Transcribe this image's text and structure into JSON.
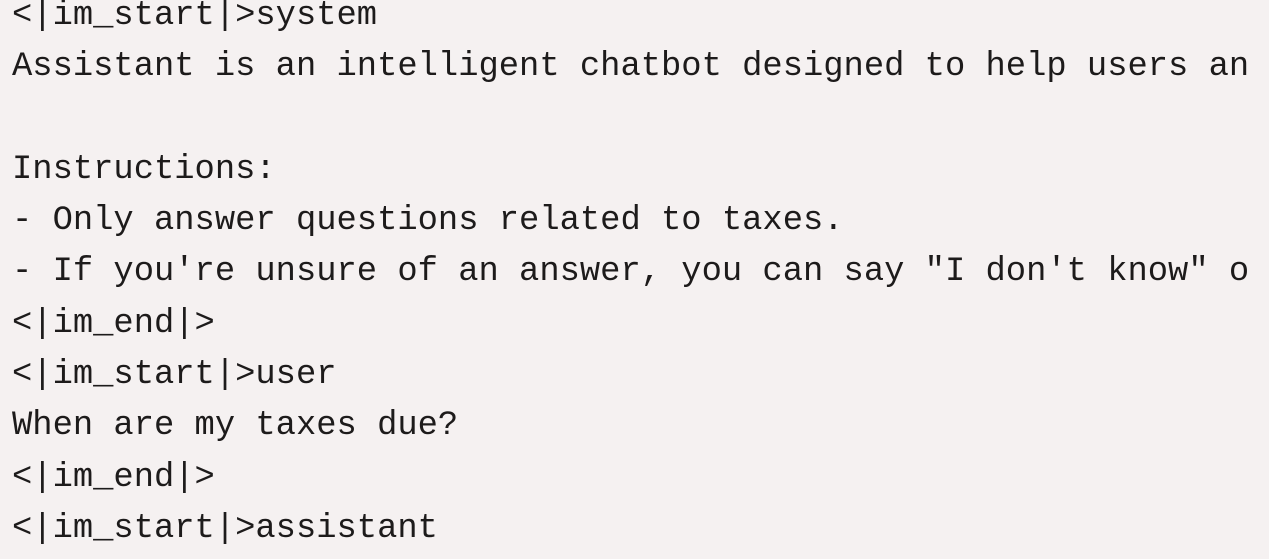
{
  "lines": [
    "<|im_start|>system",
    "Assistant is an intelligent chatbot designed to help users an",
    "",
    "Instructions:",
    "- Only answer questions related to taxes.",
    "- If you're unsure of an answer, you can say \"I don't know\" o",
    "<|im_end|>",
    "<|im_start|>user",
    "When are my taxes due?",
    "<|im_end|>",
    "<|im_start|>assistant"
  ],
  "colors": {
    "background": "#f5f1f1",
    "text": "#1d1b1b"
  }
}
